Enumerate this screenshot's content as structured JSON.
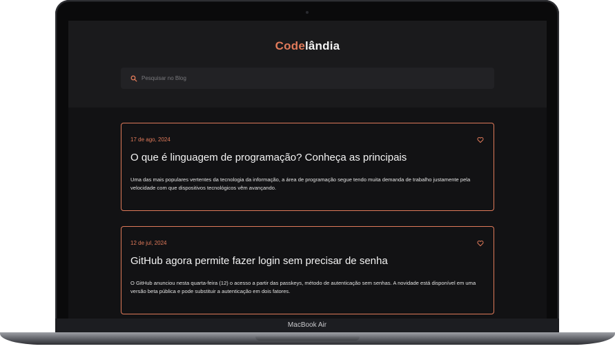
{
  "device": {
    "label": "MacBook Air"
  },
  "brand": {
    "part1": "Code",
    "part2": "lândia",
    "accent_color": "#e07a5a"
  },
  "search": {
    "placeholder": "Pesquisar no Blog",
    "value": "",
    "icon": "search-icon"
  },
  "posts": [
    {
      "date": "17 de ago, 2024",
      "title": "O que é linguagem de programação? Conheça as principais",
      "excerpt": "Uma das mais populares vertentes da tecnologia da informação, a área de programação segue tendo muita demanda de trabalho justamente pela velocidade com que dispositivos tecnológicos vêm avançando.",
      "icon": "heart-icon"
    },
    {
      "date": "12 de jul, 2024",
      "title": "GitHub agora permite fazer login sem precisar de senha",
      "excerpt": "O GitHub anunciou nesta quarta-feira (12) o acesso a partir das passkeys, método de autenticação sem senhas. A novidade está disponível em uma versão beta pública e pode substituir a autenticação em dois fatores.",
      "icon": "heart-icon"
    }
  ]
}
